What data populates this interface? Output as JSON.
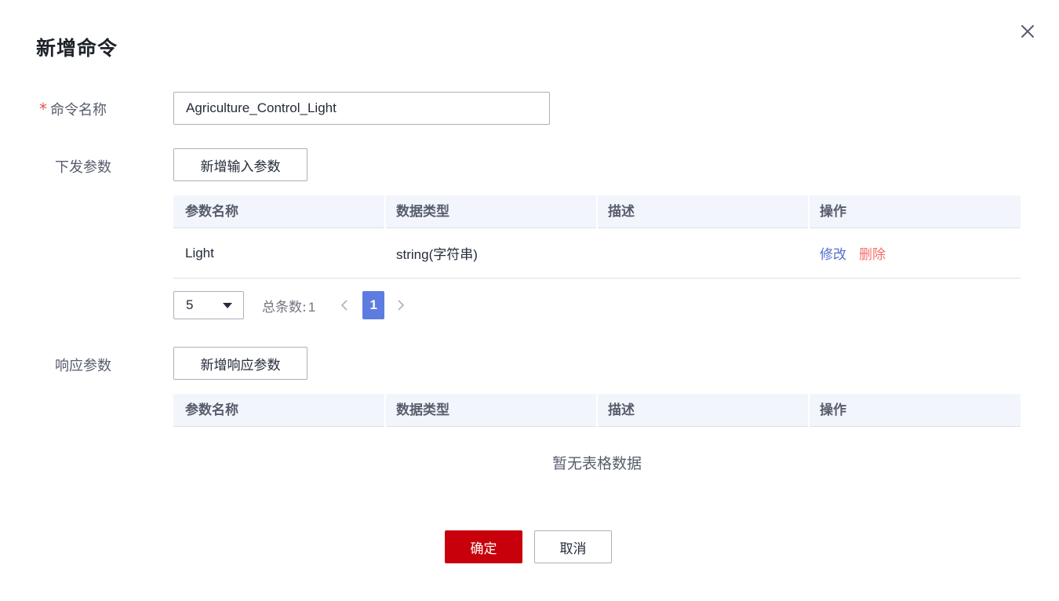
{
  "dialog": {
    "title": "新增命令",
    "close_icon": "close-icon"
  },
  "form": {
    "command_name": {
      "required_mark": "*",
      "label": "命令名称",
      "value": "Agriculture_Control_Light"
    },
    "input_params": {
      "label": "下发参数",
      "add_button": "新增输入参数",
      "columns": [
        "参数名称",
        "数据类型",
        "描述",
        "操作"
      ],
      "rows": [
        {
          "name": "Light",
          "type": "string(字符串)",
          "description": "",
          "edit": "修改",
          "delete": "删除"
        }
      ],
      "pagination": {
        "page_size": "5",
        "total_label": "总条数:",
        "total": "1",
        "current_page": "1"
      }
    },
    "response_params": {
      "label": "响应参数",
      "add_button": "新增响应参数",
      "columns": [
        "参数名称",
        "数据类型",
        "描述",
        "操作"
      ],
      "empty_text": "暂无表格数据"
    }
  },
  "footer": {
    "ok": "确定",
    "cancel": "取消"
  },
  "colors": {
    "primary": "#c7000b",
    "page_active": "#5e7ce0",
    "link": "#526ecc",
    "danger": "#f66f6a",
    "table_header_bg": "#f2f5fc"
  }
}
